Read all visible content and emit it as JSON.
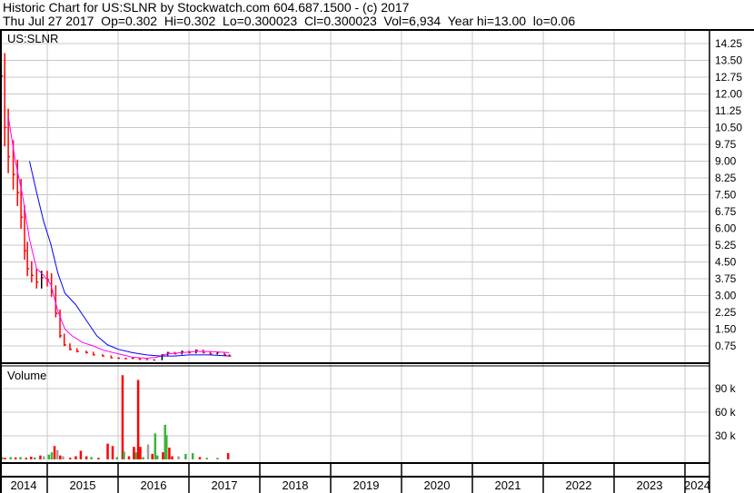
{
  "header": {
    "title": "Historic Chart for US:SLNR by Stockwatch.com 604.687.1500 - (c) 2017",
    "quote": "Thu Jul 27 2017  Op=0.302  Hi=0.302  Lo=0.300023  Cl=0.300023  Vol=6,934  Year hi=13.00  lo=0.06"
  },
  "chart_data": [
    {
      "type": "line",
      "title": "US:SLNR",
      "y_ticks": [
        "14.25",
        "13.50",
        "12.75",
        "12.00",
        "11.25",
        "10.50",
        "9.75",
        "9.00",
        "8.25",
        "7.50",
        "6.75",
        "6.00",
        "5.25",
        "4.50",
        "3.75",
        "3.00",
        "2.25",
        "1.50",
        "0.75"
      ],
      "ylim": [
        0,
        14.6
      ],
      "x_ticks": [
        "2014",
        "2015",
        "2016",
        "2017",
        "2018",
        "2019",
        "2020",
        "2021",
        "2022",
        "2023",
        "2024"
      ],
      "colors": {
        "price_up": "#000000",
        "price_down": "#ff0000",
        "ma_short": "#ff00ff",
        "ma_long": "#0000ff"
      },
      "price": [
        [
          2014.35,
          12.8
        ],
        [
          2014.4,
          10.5
        ],
        [
          2014.45,
          9.2
        ],
        [
          2014.52,
          8.4
        ],
        [
          2014.58,
          7.6
        ],
        [
          2014.63,
          6.5
        ],
        [
          2014.68,
          5.0
        ],
        [
          2014.72,
          4.2
        ],
        [
          2014.78,
          3.9
        ],
        [
          2014.85,
          3.6
        ],
        [
          2014.92,
          3.8
        ],
        [
          2015.0,
          3.7
        ],
        [
          2015.06,
          3.2
        ],
        [
          2015.12,
          2.2
        ],
        [
          2015.18,
          1.2
        ],
        [
          2015.24,
          0.8
        ],
        [
          2015.32,
          0.6
        ],
        [
          2015.42,
          0.5
        ],
        [
          2015.55,
          0.45
        ],
        [
          2015.65,
          0.35
        ],
        [
          2015.78,
          0.3
        ],
        [
          2015.9,
          0.22
        ],
        [
          2016.0,
          0.2
        ],
        [
          2016.1,
          0.18
        ],
        [
          2016.2,
          0.2
        ],
        [
          2016.3,
          0.15
        ],
        [
          2016.4,
          0.14
        ],
        [
          2016.5,
          0.12
        ],
        [
          2016.62,
          0.35
        ],
        [
          2016.7,
          0.45
        ],
        [
          2016.8,
          0.4
        ],
        [
          2016.9,
          0.5
        ],
        [
          2017.0,
          0.45
        ],
        [
          2017.1,
          0.55
        ],
        [
          2017.2,
          0.45
        ],
        [
          2017.3,
          0.4
        ],
        [
          2017.4,
          0.45
        ],
        [
          2017.5,
          0.35
        ],
        [
          2017.57,
          0.3
        ]
      ],
      "ma_short": [
        [
          2014.45,
          11.0
        ],
        [
          2014.55,
          9.0
        ],
        [
          2014.65,
          7.5
        ],
        [
          2014.75,
          5.5
        ],
        [
          2014.85,
          4.2
        ],
        [
          2014.95,
          3.9
        ],
        [
          2015.05,
          3.5
        ],
        [
          2015.15,
          2.3
        ],
        [
          2015.25,
          1.5
        ],
        [
          2015.35,
          1.2
        ],
        [
          2015.5,
          0.9
        ],
        [
          2015.65,
          0.75
        ],
        [
          2015.8,
          0.55
        ],
        [
          2016.0,
          0.4
        ],
        [
          2016.2,
          0.25
        ],
        [
          2016.4,
          0.2
        ],
        [
          2016.55,
          0.25
        ],
        [
          2016.7,
          0.4
        ],
        [
          2016.9,
          0.45
        ],
        [
          2017.1,
          0.5
        ],
        [
          2017.3,
          0.5
        ],
        [
          2017.57,
          0.45
        ]
      ],
      "ma_long": [
        [
          2014.75,
          9.0
        ],
        [
          2014.85,
          7.6
        ],
        [
          2014.95,
          6.3
        ],
        [
          2015.05,
          5.3
        ],
        [
          2015.15,
          4.0
        ],
        [
          2015.25,
          3.1
        ],
        [
          2015.4,
          2.6
        ],
        [
          2015.55,
          1.9
        ],
        [
          2015.7,
          1.2
        ],
        [
          2015.85,
          0.8
        ],
        [
          2016.0,
          0.6
        ],
        [
          2016.2,
          0.45
        ],
        [
          2016.4,
          0.35
        ],
        [
          2016.6,
          0.3
        ],
        [
          2016.8,
          0.3
        ],
        [
          2017.0,
          0.35
        ],
        [
          2017.3,
          0.35
        ],
        [
          2017.57,
          0.3
        ]
      ]
    },
    {
      "type": "bar",
      "title": "Volume",
      "y_ticks": [
        "90 k",
        "60 k",
        "30 k"
      ],
      "ylim": [
        0,
        110000
      ],
      "bars": [
        [
          2014.36,
          3000,
          "green"
        ],
        [
          2014.4,
          2000,
          "red"
        ],
        [
          2014.48,
          3000,
          "green"
        ],
        [
          2014.55,
          2500,
          "red"
        ],
        [
          2014.62,
          3000,
          "green"
        ],
        [
          2014.7,
          2000,
          "red"
        ],
        [
          2014.77,
          3500,
          "red"
        ],
        [
          2014.82,
          2500,
          "green"
        ],
        [
          2014.9,
          5000,
          "red"
        ],
        [
          2014.95,
          4000,
          "gray"
        ],
        [
          2015.02,
          6000,
          "green"
        ],
        [
          2015.06,
          9000,
          "green"
        ],
        [
          2015.1,
          17000,
          "red"
        ],
        [
          2015.14,
          12000,
          "gray"
        ],
        [
          2015.18,
          5000,
          "red"
        ],
        [
          2015.22,
          4000,
          "gray"
        ],
        [
          2015.32,
          2000,
          "red"
        ],
        [
          2015.4,
          4000,
          "red"
        ],
        [
          2015.47,
          11000,
          "red"
        ],
        [
          2015.55,
          4000,
          "red"
        ],
        [
          2015.62,
          3000,
          "green"
        ],
        [
          2015.72,
          2000,
          "red"
        ],
        [
          2015.85,
          20000,
          "red"
        ],
        [
          2015.92,
          17000,
          "red"
        ],
        [
          2015.98,
          3000,
          "green"
        ],
        [
          2016.06,
          107000,
          "red"
        ],
        [
          2016.08,
          10000,
          "green"
        ],
        [
          2016.15,
          4000,
          "red"
        ],
        [
          2016.22,
          16000,
          "red"
        ],
        [
          2016.25,
          9000,
          "green"
        ],
        [
          2016.28,
          101000,
          "red"
        ],
        [
          2016.31,
          16000,
          "red"
        ],
        [
          2016.35,
          3000,
          "green"
        ],
        [
          2016.42,
          19000,
          "gray"
        ],
        [
          2016.48,
          7000,
          "red"
        ],
        [
          2016.52,
          33000,
          "green"
        ],
        [
          2016.55,
          5000,
          "green"
        ],
        [
          2016.63,
          9000,
          "red"
        ],
        [
          2016.66,
          44000,
          "green"
        ],
        [
          2016.68,
          31000,
          "green"
        ],
        [
          2016.72,
          15000,
          "red"
        ],
        [
          2016.76,
          4000,
          "red"
        ],
        [
          2016.85,
          4000,
          "gray"
        ],
        [
          2016.95,
          7000,
          "green"
        ],
        [
          2017.05,
          8000,
          "green"
        ],
        [
          2017.15,
          3000,
          "red"
        ],
        [
          2017.25,
          2000,
          "green"
        ],
        [
          2017.4,
          2000,
          "green"
        ],
        [
          2017.55,
          8000,
          "red"
        ]
      ]
    }
  ]
}
